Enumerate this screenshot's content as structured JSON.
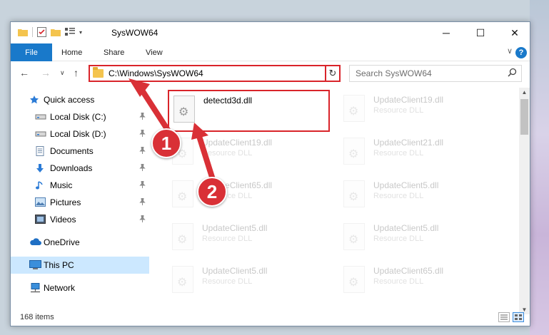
{
  "window": {
    "title": "SysWOW64",
    "controls": {
      "minimize": "─",
      "maximize": "☐",
      "close": "✕"
    }
  },
  "ribbon": {
    "tabs": [
      "File",
      "Home",
      "Share",
      "View"
    ],
    "help": "?",
    "collapse": "∨"
  },
  "nav": {
    "back": "←",
    "forward": "→",
    "recent": "∨",
    "up": "↑",
    "address": "C:\\Windows\\SysWOW64",
    "address_dropdown": "∨",
    "refresh": "↻",
    "search_placeholder": "Search SysWOW64",
    "search_icon": "⚲"
  },
  "sidebar": {
    "items": [
      {
        "label": "Quick access",
        "icon": "star-icon",
        "pinned": false
      },
      {
        "label": "Local Disk (C:)",
        "icon": "drive-icon",
        "pinned": true
      },
      {
        "label": "Local Disk (D:)",
        "icon": "drive-icon",
        "pinned": true
      },
      {
        "label": "Documents",
        "icon": "documents-icon",
        "pinned": true
      },
      {
        "label": "Downloads",
        "icon": "download-icon",
        "pinned": true
      },
      {
        "label": "Music",
        "icon": "music-icon",
        "pinned": true
      },
      {
        "label": "Pictures",
        "icon": "pictures-icon",
        "pinned": true
      },
      {
        "label": "Videos",
        "icon": "videos-icon",
        "pinned": true
      },
      {
        "label": "OneDrive",
        "icon": "cloud-icon",
        "pinned": false
      },
      {
        "label": "This PC",
        "icon": "computer-icon",
        "pinned": false,
        "selected": true
      },
      {
        "label": "Network",
        "icon": "network-icon",
        "pinned": false
      }
    ],
    "pin_glyph": "📌"
  },
  "files": [
    {
      "name": "detectd3d.dll",
      "type": "",
      "highlight": true
    },
    {
      "name": "UpdateClient19.dll",
      "type": "Resource DLL"
    },
    {
      "name": "UpdateClient19.dll",
      "type": "Resource DLL"
    },
    {
      "name": "UpdateClient21.dll",
      "type": "Resource DLL"
    },
    {
      "name": "UpdateClient65.dll",
      "type": "Resource DLL"
    },
    {
      "name": "UpdateClient5.dll",
      "type": "Resource DLL"
    },
    {
      "name": "UpdateClient5.dll",
      "type": "Resource DLL"
    },
    {
      "name": "UpdateClient5.dll",
      "type": "Resource DLL"
    },
    {
      "name": "UpdateClient5.dll",
      "type": "Resource DLL"
    },
    {
      "name": "UpdateClient65.dll",
      "type": "Resource DLL"
    }
  ],
  "status": {
    "item_count": "168 items"
  },
  "annotations": {
    "step1": "1",
    "step2": "2",
    "color": "#d93036"
  }
}
